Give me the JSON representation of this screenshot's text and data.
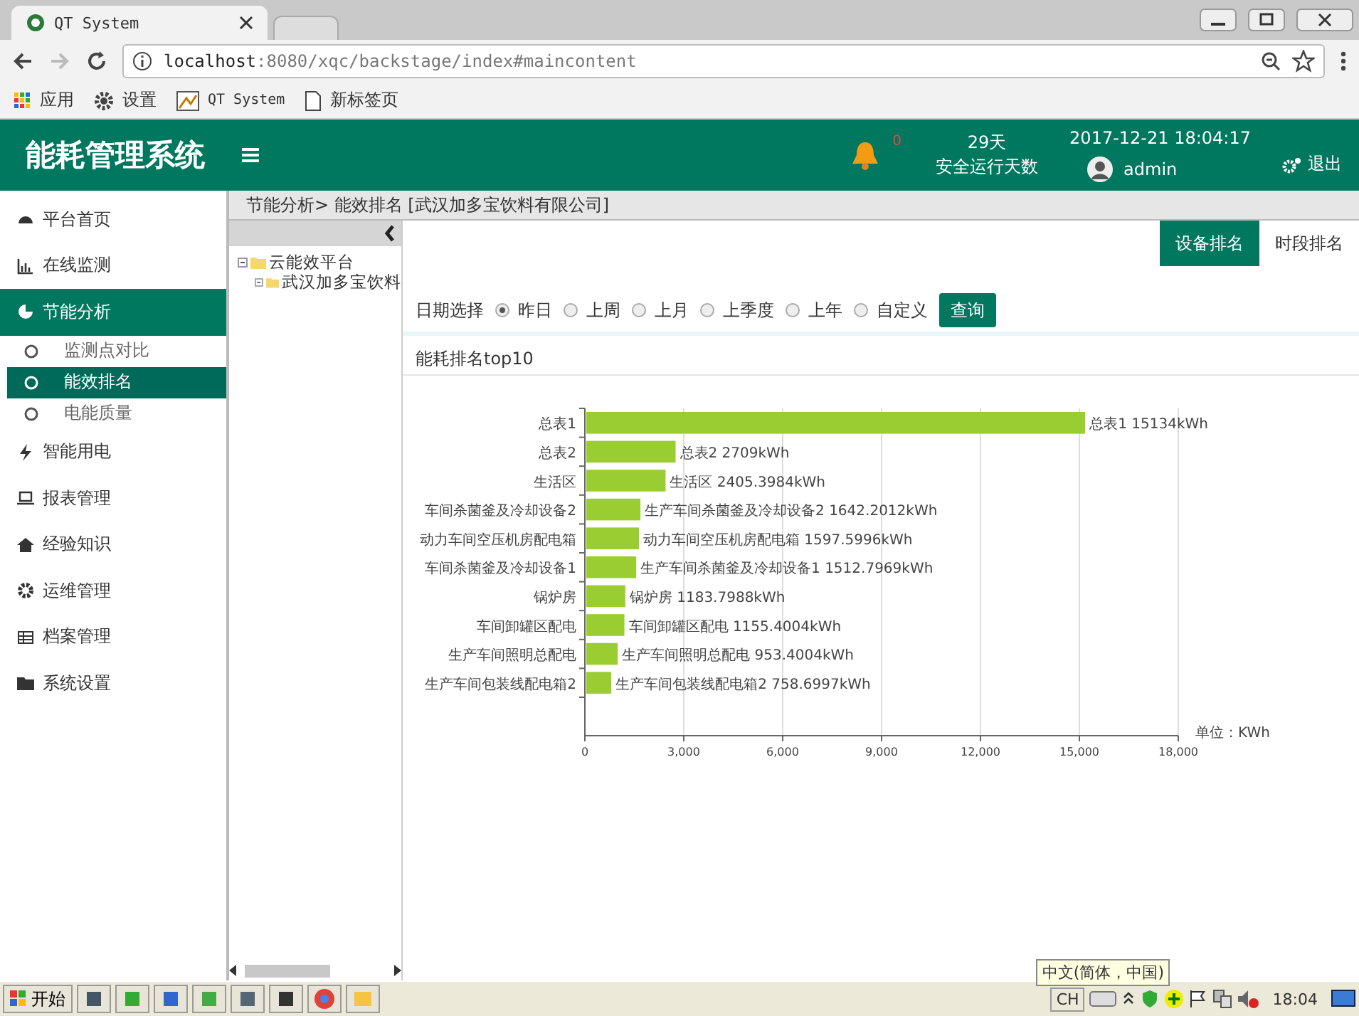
{
  "browser": {
    "tabs": [
      {
        "title": "QT System",
        "selected": true
      },
      {
        "selected": false
      }
    ],
    "url_host": "localhost",
    "url_rest": ":8080/xqc/backstage/index#maincontent",
    "bookmarks": [
      {
        "kind": "apps",
        "label": "应用"
      },
      {
        "kind": "gear",
        "label": "设置"
      },
      {
        "kind": "image",
        "label": "QT System"
      },
      {
        "kind": "page",
        "label": "新标签页"
      }
    ]
  },
  "header": {
    "title": "能耗管理系统",
    "alarm_count": "0",
    "days": "29天",
    "days_label": "安全运行天数",
    "datetime": "2017-12-21 18:04:17",
    "user": "admin",
    "logout": "退出"
  },
  "sidebar": {
    "items": [
      {
        "label": "平台首页",
        "selected": false
      },
      {
        "label": "在线监测",
        "selected": false
      },
      {
        "label": "节能分析",
        "selected": true,
        "children": [
          {
            "label": "监测点对比",
            "selected": false
          },
          {
            "label": "能效排名",
            "selected": true
          },
          {
            "label": "电能质量",
            "selected": false
          }
        ]
      },
      {
        "label": "智能用电",
        "selected": false
      },
      {
        "label": "报表管理",
        "selected": false
      },
      {
        "label": "经验知识",
        "selected": false
      },
      {
        "label": "运维管理",
        "selected": false
      },
      {
        "label": "档案管理",
        "selected": false
      },
      {
        "label": "系统设置",
        "selected": false
      }
    ]
  },
  "breadcrumb": "节能分析> 能效排名 [武汉加多宝饮料有限公司]",
  "tree": [
    {
      "label": "云能效平台",
      "expanded": true,
      "children": [
        {
          "label": "武汉加多宝饮料",
          "expanded": true
        }
      ]
    }
  ],
  "view_tabs": [
    {
      "label": "设备排名",
      "selected": true
    },
    {
      "label": "时段排名",
      "selected": false
    }
  ],
  "filter": {
    "label": "日期选择",
    "options": [
      {
        "label": "昨日",
        "selected": true
      },
      {
        "label": "上周",
        "selected": false
      },
      {
        "label": "上月",
        "selected": false
      },
      {
        "label": "上季度",
        "selected": false
      },
      {
        "label": "上年",
        "selected": false
      },
      {
        "label": "自定义",
        "selected": false
      }
    ],
    "button": "查询"
  },
  "chart_title": "能耗排名top10",
  "chart_data": {
    "type": "bar",
    "orientation": "horizontal",
    "grid": true,
    "xlabel": "单位：KWh",
    "categories": [
      "总表1",
      "总表2",
      "生活区",
      "车间杀菌釜及冷却设备2",
      "动力车间空压机房配电箱",
      "车间杀菌釜及冷却设备1",
      "锅炉房",
      "车间卸罐区配电",
      "生产车间照明总配电",
      "生产车间包装线配电箱2"
    ],
    "values": [
      15134,
      2709,
      2405.3984,
      1642.2012,
      1597.5996,
      1512.7969,
      1183.7988,
      1155.4004,
      953.4004,
      758.6997
    ],
    "value_labels": [
      "总表1 15134kWh",
      "总表2 2709kWh",
      "生活区 2405.3984kWh",
      "生产车间杀菌釜及冷却设备2 1642.2012kWh",
      "动力车间空压机房配电箱 1597.5996kWh",
      "生产车间杀菌釜及冷却设备1 1512.7969kWh",
      "锅炉房 1183.7988kWh",
      "车间卸罐区配电 1155.4004kWh",
      "生产车间照明总配电 953.4004kWh",
      "生产车间包装线配电箱2 758.6997kWh"
    ],
    "xlim": [
      0,
      18000
    ],
    "xticks": [
      {
        "value": 0,
        "label": "0"
      },
      {
        "value": 3000,
        "label": "3,000"
      },
      {
        "value": 6000,
        "label": "6,000"
      },
      {
        "value": 9000,
        "label": "9,000"
      },
      {
        "value": 12000,
        "label": "12,000"
      },
      {
        "value": 15000,
        "label": "15,000"
      },
      {
        "value": 18000,
        "label": "18,000"
      }
    ]
  },
  "taskbar": {
    "start": "开始",
    "tooltip": "中文(简体，中国)",
    "lang": "CH",
    "clock": "18:04"
  }
}
